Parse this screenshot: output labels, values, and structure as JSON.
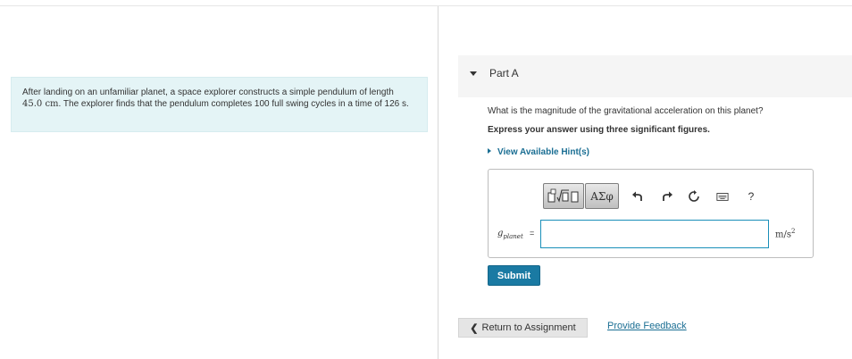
{
  "problem": {
    "text_1": "After landing on an unfamiliar planet, a space explorer constructs a simple pendulum of length ",
    "length_value": "45.0 cm",
    "text_2": ". The explorer finds that the pendulum completes 100 full swing cycles in a time of ",
    "time_value": "126 s",
    "text_3": "."
  },
  "part": {
    "title": "Part A",
    "question": "What is the magnitude of the gravitational acceleration on this planet?",
    "instruction": "Express your answer using three significant figures.",
    "hint_label": "View Available Hint(s)"
  },
  "toolbar": {
    "greek_label": "ΑΣφ",
    "help_label": "?",
    "icons": [
      "templates-icon",
      "undo-icon",
      "redo-icon",
      "reset-icon",
      "keyboard-icon",
      "help-icon"
    ]
  },
  "answer": {
    "variable": "g",
    "variable_sub": "planet",
    "equals": "=",
    "value": "",
    "unit_base": "m/s",
    "unit_exp": "2"
  },
  "actions": {
    "submit_label": "Submit",
    "return_label": "Return to Assignment",
    "feedback_label": "Provide Feedback"
  },
  "colors": {
    "accent": "#1a7aa3",
    "link": "#1a6e93",
    "problem_bg": "#e4f4f6",
    "header_bg": "#f5f5f5"
  }
}
